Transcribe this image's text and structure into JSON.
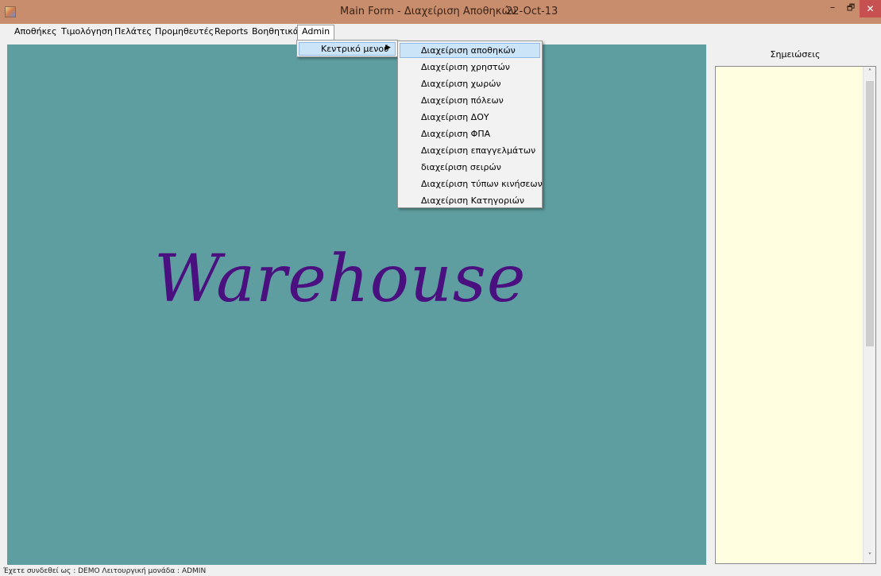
{
  "window": {
    "title": "Main Form - Διαχείριση Αποθηκών",
    "date": "22-Oct-13",
    "minimize_glyph": "–",
    "maximize_glyph": "🗗",
    "close_glyph": "✕"
  },
  "menu": {
    "items": [
      {
        "label": "Αποθήκες"
      },
      {
        "label": "Τιμολόγηση"
      },
      {
        "label": "Πελάτες"
      },
      {
        "label": "Προμηθευτές"
      },
      {
        "label": "Reports"
      },
      {
        "label": "Βοηθητικά"
      },
      {
        "label": "Admin"
      }
    ],
    "active": "Admin"
  },
  "admin_menu": {
    "item_label": "Κεντρικό μενού",
    "arrow": "▶"
  },
  "submenu": {
    "items": [
      {
        "label": "Διαχείριση αποθηκών"
      },
      {
        "label": "Διαχείριση χρηστών"
      },
      {
        "label": "Διαχείριση χωρών"
      },
      {
        "label": "Διαχείριση πόλεων"
      },
      {
        "label": "Διαχείριση ΔΟΥ"
      },
      {
        "label": "Διαχείριση ΦΠΑ"
      },
      {
        "label": "Διαχείριση επαγγελμάτων"
      },
      {
        "label": "διαχείριση σειρών"
      },
      {
        "label": "Διαχείριση τύπων κινήσεων"
      },
      {
        "label": "Διαχείριση Κατηγοριών"
      }
    ],
    "highlighted_index": 0
  },
  "workspace": {
    "watermark": "Warehouse",
    "background_color": "#5f9ea0",
    "watermark_color": "#4b1080"
  },
  "notes": {
    "header": "Σημειώσεις",
    "text": "",
    "background_color": "#fffee0",
    "scroll_up_glyph": "˄",
    "scroll_down_glyph": "˅"
  },
  "status": {
    "text": "Έχετε συνδεθεί ως : DEMO  Λειτουργική μονάδα : ADMIN"
  }
}
